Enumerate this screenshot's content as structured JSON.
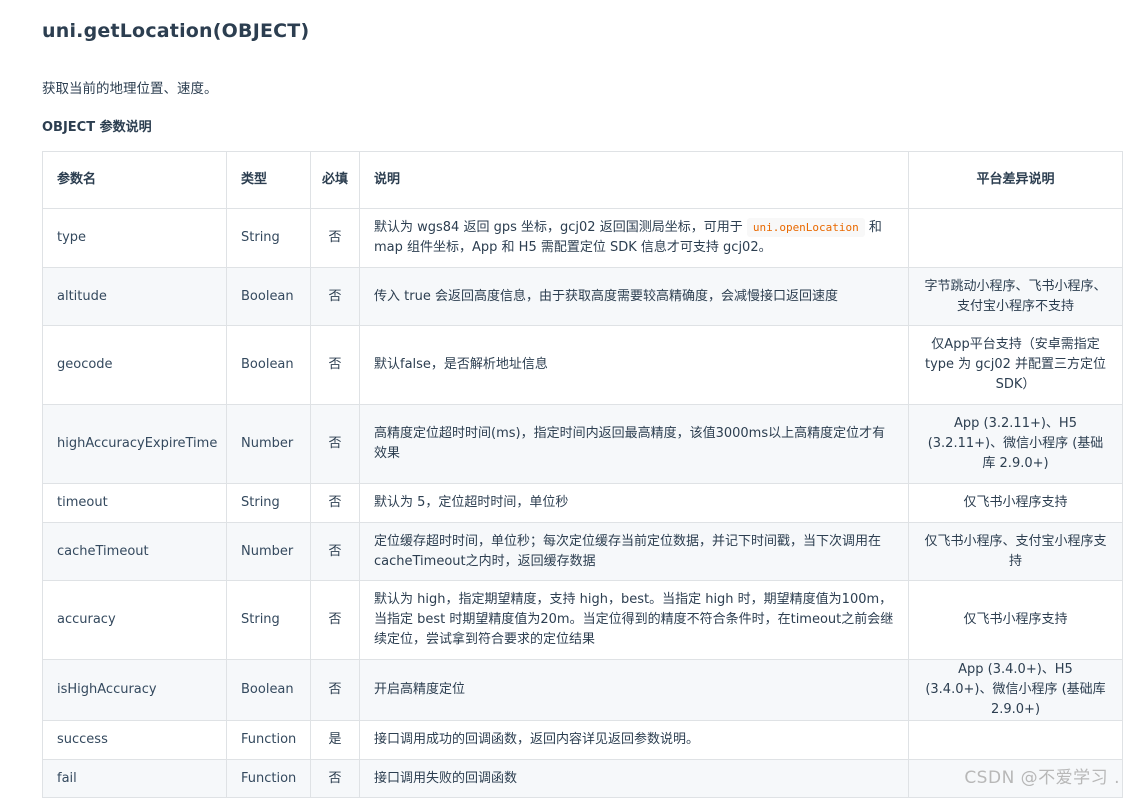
{
  "title": "uni.getLocation(OBJECT)",
  "description": "获取当前的地理位置、速度。",
  "section_title": "OBJECT 参数说明",
  "table": {
    "headers": [
      "参数名",
      "类型",
      "必填",
      "说明",
      "平台差异说明"
    ],
    "rows": [
      {
        "name": "type",
        "type": "String",
        "required": "否",
        "desc_before_code": "默认为 wgs84 返回 gps 坐标，gcj02 返回国测局坐标，可用于 ",
        "desc_code": "uni.openLocation",
        "desc_after_code": " 和 map 组件坐标，App 和 H5 需配置定位 SDK 信息才可支持 gcj02。",
        "platform": ""
      },
      {
        "name": "altitude",
        "type": "Boolean",
        "required": "否",
        "desc": "传入 true 会返回高度信息，由于获取高度需要较高精确度，会减慢接口返回速度",
        "platform": "字节跳动小程序、飞书小程序、支付宝小程序不支持"
      },
      {
        "name": "geocode",
        "type": "Boolean",
        "required": "否",
        "desc": "默认false，是否解析地址信息",
        "platform": "仅App平台支持（安卓需指定 type 为 gcj02 并配置三方定位SDK）"
      },
      {
        "name": "highAccuracyExpireTime",
        "type": "Number",
        "required": "否",
        "desc": "高精度定位超时时间(ms)，指定时间内返回最高精度，该值3000ms以上高精度定位才有效果",
        "platform": "App (3.2.11+)、H5 (3.2.11+)、微信小程序 (基础库 2.9.0+)"
      },
      {
        "name": "timeout",
        "type": "String",
        "required": "否",
        "desc": "默认为 5，定位超时时间，单位秒",
        "platform": "仅飞书小程序支持"
      },
      {
        "name": "cacheTimeout",
        "type": "Number",
        "required": "否",
        "desc": "定位缓存超时时间，单位秒；每次定位缓存当前定位数据，并记下时间戳，当下次调用在cacheTimeout之内时，返回缓存数据",
        "platform": "仅飞书小程序、支付宝小程序支持"
      },
      {
        "name": "accuracy",
        "type": "String",
        "required": "否",
        "desc": "默认为 high，指定期望精度，支持 high，best。当指定 high 时，期望精度值为100m，当指定 best 时期望精度值为20m。当定位得到的精度不符合条件时，在timeout之前会继续定位，尝试拿到符合要求的定位结果",
        "platform": "仅飞书小程序支持"
      },
      {
        "name": "isHighAccuracy",
        "type": "Boolean",
        "required": "否",
        "desc": "开启高精度定位",
        "platform": "App (3.4.0+)、H5 (3.4.0+)、微信小程序 (基础库 2.9.0+)"
      },
      {
        "name": "success",
        "type": "Function",
        "required": "是",
        "desc": "接口调用成功的回调函数，返回内容详见返回参数说明。",
        "platform": ""
      },
      {
        "name": "fail",
        "type": "Function",
        "required": "否",
        "desc": "接口调用失败的回调函数",
        "platform": ""
      }
    ]
  },
  "watermark": "CSDN @不爱学习 ."
}
